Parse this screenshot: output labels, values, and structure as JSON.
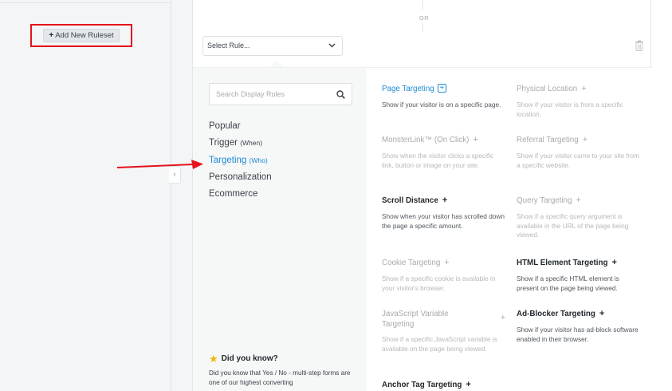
{
  "sidebar": {
    "add_ruleset_label": "Add New Ruleset"
  },
  "header": {
    "or_label": "OR",
    "select_rule_label": "Select Rule..."
  },
  "search": {
    "placeholder": "Search Display Rules"
  },
  "categories": [
    {
      "label": "Popular",
      "sub": ""
    },
    {
      "label": "Trigger",
      "sub": "(When)"
    },
    {
      "label": "Targeting",
      "sub": "(Who)"
    },
    {
      "label": "Personalization",
      "sub": ""
    },
    {
      "label": "Ecommerce",
      "sub": ""
    }
  ],
  "did_you_know": {
    "title": "Did you know?",
    "text": "Did you know that Yes / No - multi-step forms are one of our highest converting"
  },
  "rules": [
    {
      "title": "Page Targeting",
      "desc": "Show if your visitor is on a specific page."
    },
    {
      "title": "Physical Location",
      "desc": "Show if your visitor is from a specific location."
    },
    {
      "title": "MonsterLink™ (On Click)",
      "desc": "Show when the visitor clicks a specific link, button or image on your site."
    },
    {
      "title": "Referral Targeting",
      "desc": "Show if your visitor came to your site from a specific website."
    },
    {
      "title": "Scroll Distance",
      "desc": "Show when your visitor has scrolled down the page a specific amount."
    },
    {
      "title": "Query Targeting",
      "desc": "Show if a specific query argument is available in the URL of the page being viewed."
    },
    {
      "title": "Cookie Targeting",
      "desc": "Show if a specific cookie is available in your visitor's browser."
    },
    {
      "title": "HTML Element Targeting",
      "desc": "Show if a specific HTML element is present on the page being viewed."
    },
    {
      "title": "JavaScript Variable Targeting",
      "desc": "Show if a specific JavaScript variable is available on the page being viewed."
    },
    {
      "title": "Ad-Blocker Targeting",
      "desc": "Show if your visitor has ad-block software enabled in their browser."
    },
    {
      "title": "Anchor Tag Targeting",
      "desc": ""
    }
  ],
  "icons": {
    "plus": "+",
    "chevron": "⌄",
    "collapse": "‹",
    "star": "★"
  },
  "colors": {
    "accent_blue": "#1d8ad3",
    "highlight_red": "#e3131b",
    "star": "#f0b400"
  }
}
